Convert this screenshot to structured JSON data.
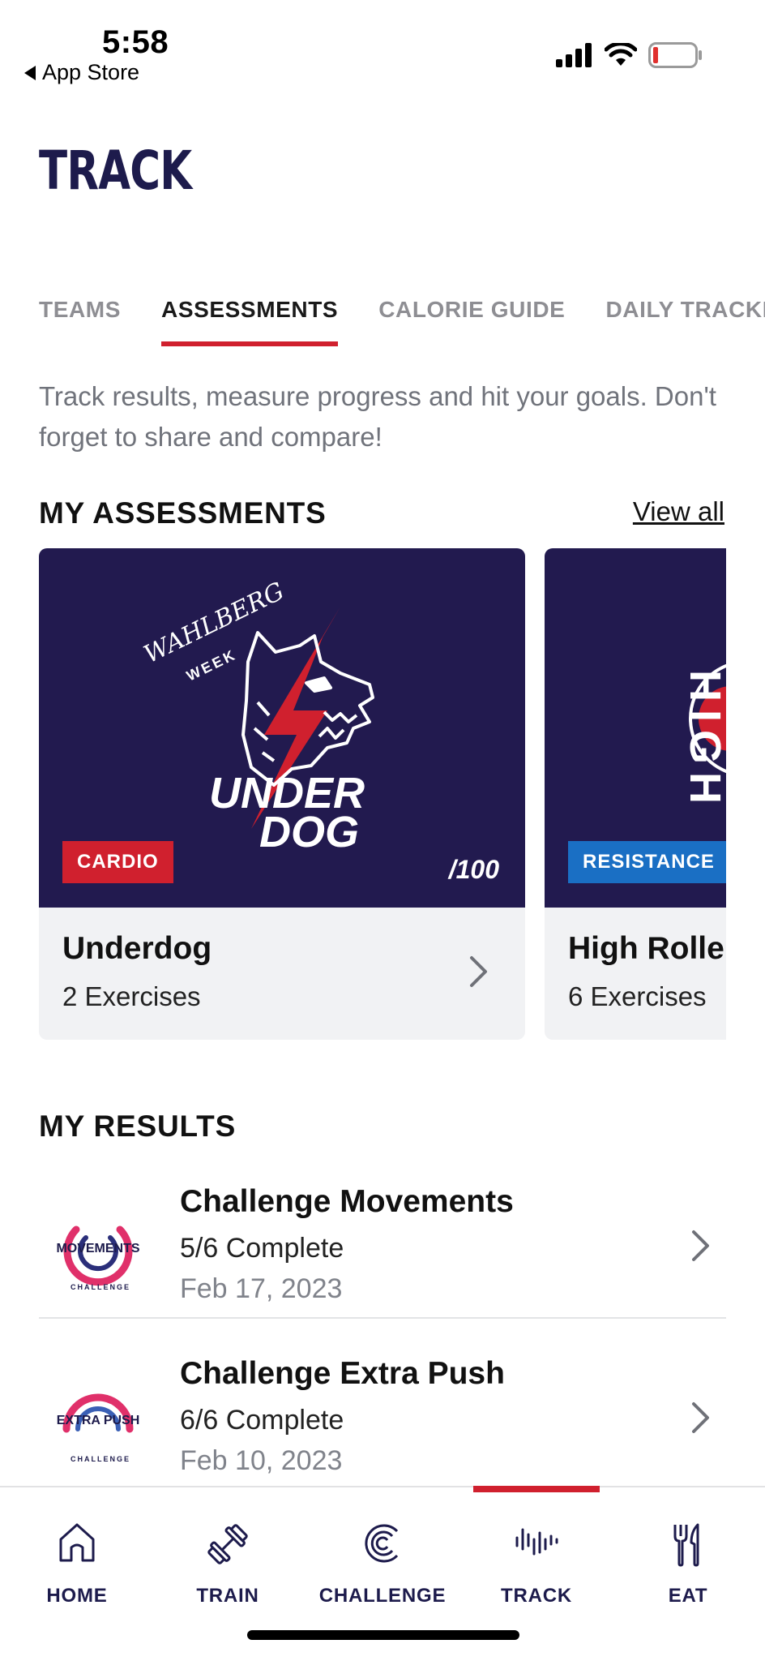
{
  "status_bar": {
    "time": "5:58",
    "back_label": "App Store"
  },
  "page": {
    "title": "TRACK"
  },
  "tabs": [
    {
      "label": "TEAMS"
    },
    {
      "label": "ASSESSMENTS"
    },
    {
      "label": "CALORIE GUIDE"
    },
    {
      "label": "DAILY TRACKER"
    }
  ],
  "intro": "Track results, measure progress and hit your goals. Don't forget to share and compare!",
  "assessments": {
    "title": "MY ASSESSMENTS",
    "view_all": "View all",
    "cards": [
      {
        "name": "Underdog",
        "exercises": "2 Exercises",
        "badge": "CARDIO",
        "score": "/100",
        "art": {
          "top": "WAHLBERG",
          "mid": "WEEK",
          "line1": "UNDER",
          "line2": "DOG"
        }
      },
      {
        "name": "High Roller",
        "exercises": "6 Exercises",
        "badge": "RESISTANCE",
        "art": {
          "text": "HIGH"
        }
      }
    ]
  },
  "results": {
    "title": "MY RESULTS",
    "items": [
      {
        "title": "Challenge Movements",
        "status": "5/6 Complete",
        "date": "Feb 17, 2023",
        "logo": {
          "word": "MOVEMENTS",
          "sub": "CHALLENGE"
        }
      },
      {
        "title": "Challenge Extra Push",
        "status": "6/6 Complete",
        "date": "Feb 10, 2023",
        "logo": {
          "word": "EXTRA PUSH",
          "sub": "CHALLENGE"
        }
      }
    ]
  },
  "nav": [
    {
      "label": "HOME",
      "icon": "home-icon"
    },
    {
      "label": "TRAIN",
      "icon": "dumbbell-icon"
    },
    {
      "label": "CHALLENGE",
      "icon": "challenge-icon"
    },
    {
      "label": "TRACK",
      "icon": "track-icon"
    },
    {
      "label": "EAT",
      "icon": "utensils-icon"
    }
  ],
  "nav_active": "TRACK",
  "colors": {
    "accent": "#d0202e",
    "navy": "#1d1b4c",
    "card_art": "#221a4f",
    "badge_blue": "#1a6fc4"
  }
}
